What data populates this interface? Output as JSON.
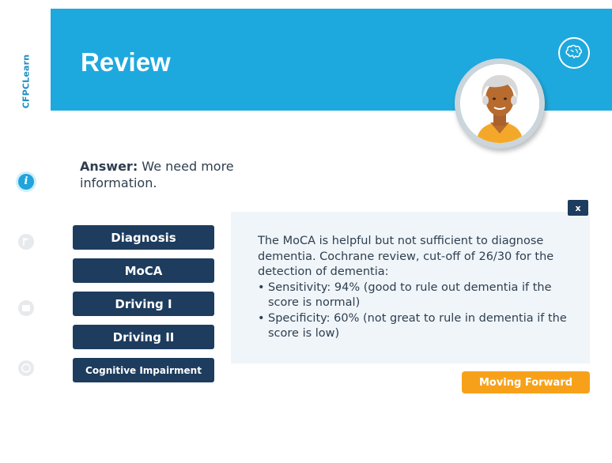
{
  "sidebar": {
    "brand": "CFPCLearn",
    "icons": [
      "info-icon",
      "flag-icon",
      "document-icon",
      "clock-icon"
    ],
    "info_glyph": "i"
  },
  "header": {
    "title": "Review",
    "badge_icon": "brain-icon"
  },
  "answer": {
    "label": "Answer:",
    "text": " We need more information."
  },
  "menu": {
    "items": [
      {
        "label": "Diagnosis"
      },
      {
        "label": "MoCA"
      },
      {
        "label": "Driving I"
      },
      {
        "label": "Driving II"
      },
      {
        "label": "Cognitive Impairment"
      }
    ]
  },
  "panel": {
    "close_label": "x",
    "paragraph": "The MoCA is helpful but not sufficient to diagnose dementia. Cochrane review, cut-off of 26/30 for the detection of dementia:",
    "bullets": [
      "Sensitivity: 94% (good to rule out dementia if the score is normal)",
      "Specificity: 60% (not great to rule in dementia if the score is low)"
    ]
  },
  "footer": {
    "forward_label": "Moving Forward"
  },
  "colors": {
    "header": "#1ea9de",
    "navy": "#1d3c5e",
    "orange": "#f7a11a",
    "panel": "#f0f5f9"
  }
}
